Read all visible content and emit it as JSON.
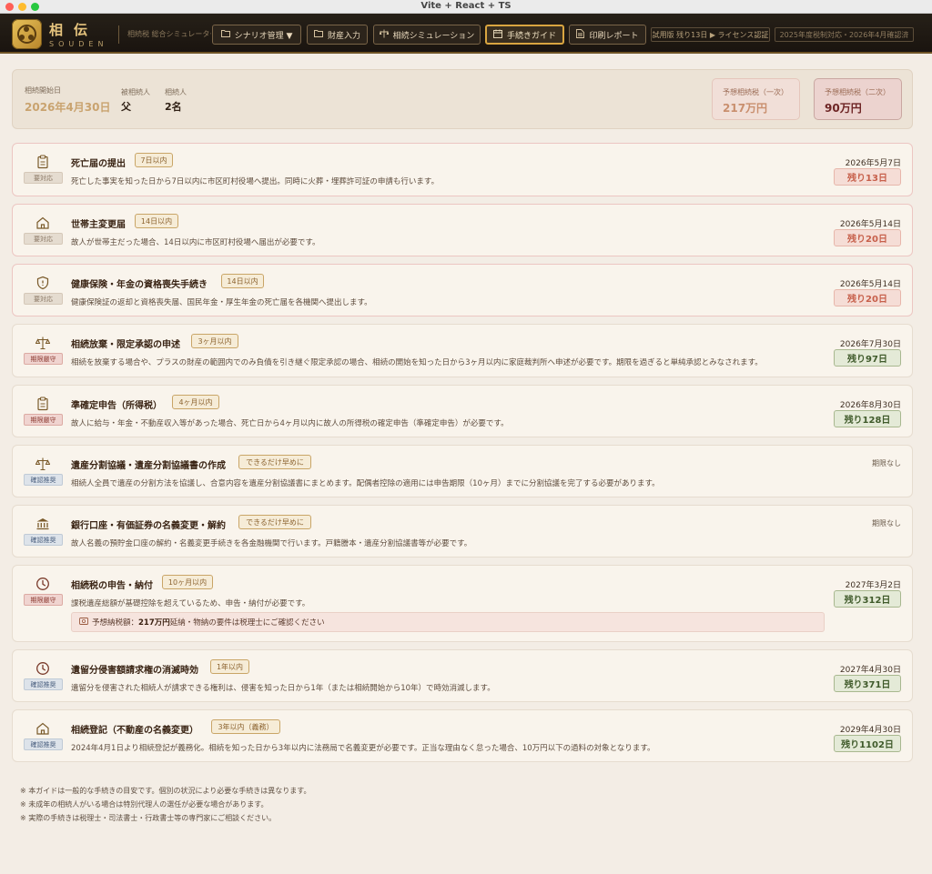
{
  "window": {
    "title": "Vite + React + TS"
  },
  "header": {
    "brand_jp": "相伝",
    "brand_en": "SOUDEN",
    "subtitle": "相続税 総合シミュレーター",
    "nav": {
      "scenario": "シナリオ管理 ▼",
      "asset_input": "財産入力",
      "simulation": "相続シミュレーション",
      "guide": "手続きガイド",
      "report": "印刷レポート"
    },
    "license": "試用版 残り13日 ▶ ライセンス認証",
    "tax_year": "2025年度税制対応・2026年4月確認済"
  },
  "summary": {
    "start_label": "相続開始日",
    "start_value": "2026年4月30日",
    "deceased_label": "被相続人",
    "deceased_value": "父",
    "heirs_label": "相続人",
    "heirs_value": "2名",
    "tax1_label": "予想相続税（一次）",
    "tax1_value": "217万円",
    "tax2_label": "予想相続税（二次）",
    "tax2_value": "90万円"
  },
  "procedures": [
    {
      "icon": "clipboard-icon",
      "category": "要対応",
      "title": "死亡届の提出",
      "deadline": "7日以内",
      "desc": "死亡した事実を知った日から7日以内に市区町村役場へ提出。同時に火葬・埋葬許可証の申請も行います。",
      "date": "2026年5月7日",
      "remaining": "残り13日"
    },
    {
      "icon": "house-icon",
      "category": "要対応",
      "title": "世帯主変更届",
      "deadline": "14日以内",
      "desc": "故人が世帯主だった場合、14日以内に市区町村役場へ届出が必要です。",
      "date": "2026年5月14日",
      "remaining": "残り20日"
    },
    {
      "icon": "shield-icon",
      "category": "要対応",
      "title": "健康保険・年金の資格喪失手続き",
      "deadline": "14日以内",
      "desc": "健康保険証の返却と資格喪失届、国民年金・厚生年金の死亡届を各機関へ提出します。",
      "date": "2026年5月14日",
      "remaining": "残り20日"
    },
    {
      "icon": "scale-icon",
      "category": "期限厳守",
      "title": "相続放棄・限定承認の申述",
      "deadline": "3ヶ月以内",
      "desc": "相続を放棄する場合や、プラスの財産の範囲内でのみ負債を引き継ぐ限定承認の場合、相続の開始を知った日から3ヶ月以内に家庭裁判所へ申述が必要です。期限を過ぎると単純承認とみなされます。",
      "date": "2026年7月30日",
      "remaining": "残り97日"
    },
    {
      "icon": "clipboard-icon",
      "category": "期限厳守",
      "title": "準確定申告（所得税）",
      "deadline": "4ヶ月以内",
      "desc": "故人に給与・年金・不動産収入等があった場合、死亡日から4ヶ月以内に故人の所得税の確定申告（準確定申告）が必要です。",
      "date": "2026年8月30日",
      "remaining": "残り128日"
    },
    {
      "icon": "scale-icon",
      "category": "確認推奨",
      "title": "遺産分割協議・遺産分割協議書の作成",
      "deadline": "できるだけ早めに",
      "desc": "相続人全員で遺産の分割方法を協議し、合意内容を遺産分割協議書にまとめます。配偶者控除の適用には申告期限（10ヶ月）までに分割協議を完了する必要があります。",
      "no_deadline": "期限なし"
    },
    {
      "icon": "bank-icon",
      "category": "確認推奨",
      "title": "銀行口座・有価証券の名義変更・解約",
      "deadline": "できるだけ早めに",
      "desc": "故人名義の預貯金口座の解約・名義変更手続きを各金融機関で行います。戸籍謄本・遺産分割協議書等が必要です。",
      "no_deadline": "期限なし"
    },
    {
      "icon": "clock-icon",
      "category": "期限厳守",
      "title": "相続税の申告・納付",
      "deadline": "10ヶ月以内",
      "desc": "課税遺産総額が基礎控除を超えているため、申告・納付が必要です。",
      "date": "2027年3月2日",
      "remaining": "残り312日",
      "note_prefix": "予想納税額：",
      "note_amount": "217万円",
      "note_suffix": "延納・物納の要件は税理士にご確認ください"
    },
    {
      "icon": "clock-icon",
      "category": "確認推奨",
      "title": "遺留分侵害額請求権の消滅時効",
      "deadline": "1年以内",
      "desc": "遺留分を侵害された相続人が請求できる権利は、侵害を知った日から1年（または相続開始から10年）で時効消滅します。",
      "date": "2027年4月30日",
      "remaining": "残り371日"
    },
    {
      "icon": "house-icon",
      "category": "確認推奨",
      "title": "相続登記（不動産の名義変更）",
      "deadline": "3年以内（義務）",
      "desc": "2024年4月1日より相続登記が義務化。相続を知った日から3年以内に法務局で名義変更が必要です。正当な理由なく怠った場合、10万円以下の過料の対象となります。",
      "date": "2029年4月30日",
      "remaining": "残り1102日"
    }
  ],
  "footnotes": [
    "※ 本ガイドは一般的な手続きの目安です。個別の状況により必要な手続きは異なります。",
    "※ 未成年の相続人がいる場合は特別代理人の選任が必要な場合があります。",
    "※ 実際の手続きは税理士・司法書士・行政書士等の専門家にご相談ください。"
  ],
  "colors": {
    "accent_gold": "#d9a540",
    "header_bg": "#1a140f",
    "urgent_red": "#c7604b",
    "ok_green": "#3f5a2a"
  }
}
